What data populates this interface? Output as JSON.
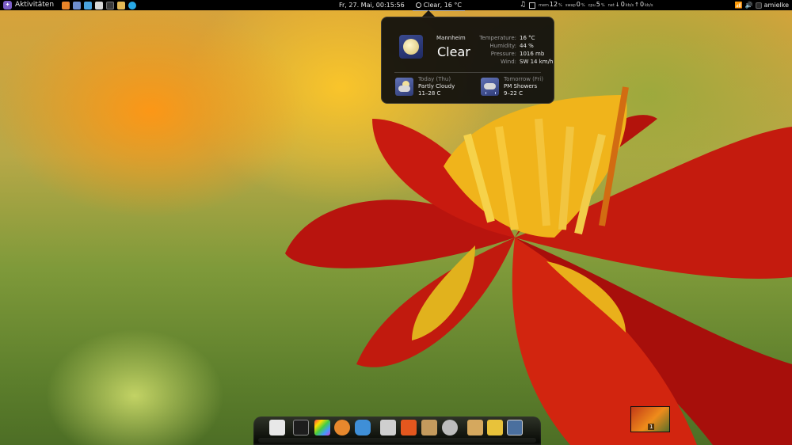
{
  "panel": {
    "activities": "Aktivitäten",
    "datetime": "Fr, 27. Mai, 00:15:56",
    "weather_indicator": "Clear, 16 °C",
    "launchers": [
      {
        "name": "firefox",
        "color": "#e9852a"
      },
      {
        "name": "files",
        "color": "#6d8ecf"
      },
      {
        "name": "chat",
        "color": "#4aa3df"
      },
      {
        "name": "text-editor",
        "color": "#d8d8d8"
      },
      {
        "name": "terminal",
        "color": "#3b3b3b"
      },
      {
        "name": "archive",
        "color": "#e2b855"
      },
      {
        "name": "skype",
        "color": "#28a8e6"
      }
    ],
    "system": {
      "mem_label": "mem",
      "mem_value": "12",
      "mem_unit": "%",
      "swap_label": "swap",
      "swap_value": "0",
      "swap_unit": "%",
      "cpu_label": "cpu",
      "cpu_value": "5",
      "cpu_unit": "%",
      "net_label": "net",
      "net_down": "0",
      "net_down_unit": "kb/s",
      "net_up": "0",
      "net_up_unit": "kb/s"
    },
    "user": "amielke"
  },
  "weather_popup": {
    "city": "Mannheim",
    "condition": "Clear",
    "details": [
      {
        "label": "Temperature:",
        "value": "16 °C"
      },
      {
        "label": "Humidity:",
        "value": "44 %"
      },
      {
        "label": "Pressure:",
        "value": "1016 mb"
      },
      {
        "label": "Wind:",
        "value": "SW 14 km/h"
      }
    ],
    "forecast": [
      {
        "day": "Today (Thu)",
        "condition": "Partly Cloudy",
        "temp": "11–28 C"
      },
      {
        "day": "Tomorrow (Fri)",
        "condition": "PM Showers",
        "temp": "9–22 C"
      }
    ]
  },
  "dock": {
    "items": [
      {
        "name": "text-editor",
        "color": "#e8e8e8"
      },
      {
        "name": "terminal",
        "color": "#1d1d1d"
      },
      {
        "name": "color-picker",
        "color": "#c94bd0"
      },
      {
        "name": "firefox",
        "color": "#e7882d"
      },
      {
        "name": "chat",
        "color": "#3f8fd7"
      },
      {
        "name": "document-viewer",
        "color": "#cfcfcf"
      },
      {
        "name": "ubuntu-software",
        "color": "#e4571e"
      },
      {
        "name": "file-manager",
        "color": "#c49a5d"
      },
      {
        "name": "settings",
        "color": "#bdbdbd"
      },
      {
        "name": "archive",
        "color": "#d5a85e"
      },
      {
        "name": "image-viewer",
        "color": "#e8c23a"
      },
      {
        "name": "workspace-switcher",
        "color": "#4a6f9e"
      }
    ]
  },
  "workspace": {
    "number": "1"
  }
}
